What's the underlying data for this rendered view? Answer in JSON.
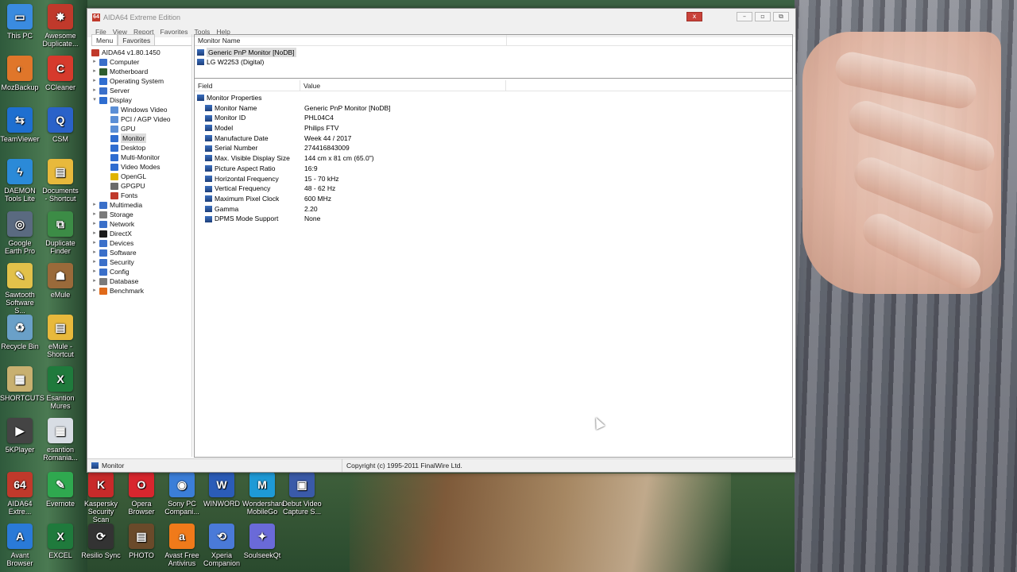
{
  "window": {
    "title": "AIDA64 Extreme Edition",
    "menu": [
      "File",
      "View",
      "Report",
      "Favorites",
      "Tools",
      "Help"
    ],
    "controls": {
      "close": "x",
      "minimize": "–",
      "maximize": "▫",
      "restore": "⧉"
    }
  },
  "left_pane": {
    "tabs": [
      "Menu",
      "Favorites"
    ],
    "root": "AIDA64 v1.80.1450",
    "tree": [
      {
        "label": "Computer",
        "expander": "▸",
        "icon_color": "#3a6fc9"
      },
      {
        "label": "Motherboard",
        "expander": "▸",
        "icon_color": "#2e5d2e"
      },
      {
        "label": "Operating System",
        "expander": "▸",
        "icon_color": "#2f6dd0"
      },
      {
        "label": "Server",
        "expander": "▸",
        "icon_color": "#3a6fc9"
      },
      {
        "label": "Display",
        "expander": "▾",
        "icon_color": "#2f6dd0"
      },
      {
        "label": "Windows Video",
        "child": true,
        "icon_color": "#5b8fd6"
      },
      {
        "label": "PCI / AGP Video",
        "child": true,
        "icon_color": "#5b8fd6"
      },
      {
        "label": "GPU",
        "child": true,
        "icon_color": "#5b8fd6"
      },
      {
        "label": "Monitor",
        "child": true,
        "selected": true,
        "icon_color": "#2f6dd0"
      },
      {
        "label": "Desktop",
        "child": true,
        "icon_color": "#2f6dd0"
      },
      {
        "label": "Multi-Monitor",
        "child": true,
        "icon_color": "#2f6dd0"
      },
      {
        "label": "Video Modes",
        "child": true,
        "icon_color": "#2f6dd0"
      },
      {
        "label": "OpenGL",
        "child": true,
        "icon_color": "#e0b400"
      },
      {
        "label": "GPGPU",
        "child": true,
        "icon_color": "#6a6a6a"
      },
      {
        "label": "Fonts",
        "child": true,
        "icon_color": "#c0392b"
      },
      {
        "label": "Multimedia",
        "expander": "▸",
        "icon_color": "#3a6fc9"
      },
      {
        "label": "Storage",
        "expander": "▸",
        "icon_color": "#7a7a7a"
      },
      {
        "label": "Network",
        "expander": "▸",
        "icon_color": "#3a6fc9"
      },
      {
        "label": "DirectX",
        "expander": "▸",
        "icon_color": "#1a1a1a"
      },
      {
        "label": "Devices",
        "expander": "▸",
        "icon_color": "#3a6fc9"
      },
      {
        "label": "Software",
        "expander": "▸",
        "icon_color": "#3a6fc9"
      },
      {
        "label": "Security",
        "expander": "▸",
        "icon_color": "#3a6fc9"
      },
      {
        "label": "Config",
        "expander": "▸",
        "icon_color": "#3a6fc9"
      },
      {
        "label": "Database",
        "expander": "▸",
        "icon_color": "#7a7a7a"
      },
      {
        "label": "Benchmark",
        "expander": "▸",
        "icon_color": "#e06a1a"
      }
    ]
  },
  "devices": {
    "header": "Monitor Name",
    "items": [
      {
        "label": "Generic PnP Monitor [NoDB]",
        "selected": true
      },
      {
        "label": "LG W2253 (Digital)",
        "selected": false
      }
    ]
  },
  "grid": {
    "headers": [
      "Field",
      "Value"
    ],
    "section": "Monitor Properties",
    "rows": [
      {
        "field": "Monitor Name",
        "value": "Generic PnP Monitor [NoDB]"
      },
      {
        "field": "Monitor ID",
        "value": "PHL04C4"
      },
      {
        "field": "Model",
        "value": "Philips FTV"
      },
      {
        "field": "Manufacture Date",
        "value": "Week 44 / 2017"
      },
      {
        "field": "Serial Number",
        "value": "274416843009"
      },
      {
        "field": "Max. Visible Display Size",
        "value": "144 cm x 81 cm (65.0\")"
      },
      {
        "field": "Picture Aspect Ratio",
        "value": "16:9"
      },
      {
        "field": "Horizontal Frequency",
        "value": "15 - 70 kHz"
      },
      {
        "field": "Vertical Frequency",
        "value": "48 - 62 Hz"
      },
      {
        "field": "Maximum Pixel Clock",
        "value": "600 MHz"
      },
      {
        "field": "Gamma",
        "value": "2.20"
      },
      {
        "field": "DPMS Mode Support",
        "value": "None"
      }
    ]
  },
  "statusbar": {
    "left": "Monitor",
    "right": "Copyright (c) 1995-2011 FinalWire Ltd."
  },
  "desktop_icons": [
    {
      "label": "This PC",
      "icon": "pc-icon",
      "color": "#3a8be0",
      "glyph": "▭"
    },
    {
      "label": "Awesome Duplicate...",
      "icon": "awesome-duplicate-icon",
      "color": "#c0392b",
      "glyph": "✸"
    },
    {
      "label": "MozBackup",
      "icon": "mozbackup-icon",
      "color": "#e0762a",
      "glyph": "◐"
    },
    {
      "label": "CCleaner",
      "icon": "ccleaner-icon",
      "color": "#d63a2c",
      "glyph": "C"
    },
    {
      "label": "TeamViewer",
      "icon": "teamviewer-icon",
      "color": "#1e6fd0",
      "glyph": "⇆"
    },
    {
      "label": "CSM",
      "icon": "csm-icon",
      "color": "#2a62c9",
      "glyph": "Q"
    },
    {
      "label": "DAEMON Tools Lite",
      "icon": "daemon-tools-icon",
      "color": "#2b8ad8",
      "glyph": "ϟ"
    },
    {
      "label": "Documents - Shortcut",
      "icon": "folder-icon",
      "color": "#e8b93c",
      "glyph": "▤"
    },
    {
      "label": "Google Earth Pro",
      "icon": "google-earth-icon",
      "color": "#5a6a80",
      "glyph": "◎"
    },
    {
      "label": "Duplicate Finder",
      "icon": "duplicate-finder-icon",
      "color": "#3c8c46",
      "glyph": "⧉"
    },
    {
      "label": "Sawtooth Software S...",
      "icon": "sawtooth-icon",
      "color": "#e2c14a",
      "glyph": "✎"
    },
    {
      "label": "eMule",
      "icon": "emule-icon",
      "color": "#9a6a3a",
      "glyph": "☗"
    },
    {
      "label": "Recycle Bin",
      "icon": "recycle-bin-icon",
      "color": "#6aa0c8",
      "glyph": "♻"
    },
    {
      "label": "eMule - Shortcut",
      "icon": "folder-icon",
      "color": "#e8b93c",
      "glyph": "▤"
    },
    {
      "label": "SHORTCUTS",
      "icon": "shortcuts-icon",
      "color": "#c8b070",
      "glyph": "▦"
    },
    {
      "label": "Esantion Mures",
      "icon": "excel-icon",
      "color": "#1f7a3c",
      "glyph": "X"
    },
    {
      "label": "5KPlayer",
      "icon": "5kplayer-icon",
      "color": "#444",
      "glyph": "▶"
    },
    {
      "label": "esantion Romania...",
      "icon": "spreadsheet-icon",
      "color": "#d8dde4",
      "glyph": "▦"
    },
    {
      "label": "AIDA64 Extre...",
      "icon": "aida64-icon",
      "color": "#c0392b",
      "glyph": "64"
    },
    {
      "label": "Evernote",
      "icon": "evernote-icon",
      "color": "#2fa84f",
      "glyph": "✎"
    },
    {
      "label": "Kaspersky Security Scan",
      "icon": "kaspersky-icon",
      "color": "#c82a2a",
      "glyph": "K"
    },
    {
      "label": "Opera Browser",
      "icon": "opera-icon",
      "color": "#d8262e",
      "glyph": "O"
    },
    {
      "label": "Sony PC Compani...",
      "icon": "sony-pc-companion-icon",
      "color": "#3b7ed8",
      "glyph": "◉"
    },
    {
      "label": "WINWORD",
      "icon": "word-icon",
      "color": "#2b5cb8",
      "glyph": "W"
    },
    {
      "label": "Wondershare MobileGo",
      "icon": "mobilego-icon",
      "color": "#1e9ad6",
      "glyph": "M"
    },
    {
      "label": "Debut Video Capture S...",
      "icon": "debut-video-icon",
      "color": "#3a5aa8",
      "glyph": "▣"
    },
    {
      "label": "Avant Browser",
      "icon": "avant-browser-icon",
      "color": "#2a7ad8",
      "glyph": "A"
    },
    {
      "label": "EXCEL",
      "icon": "excel-icon",
      "color": "#1f7a3c",
      "glyph": "X"
    },
    {
      "label": "Resilio Sync",
      "icon": "resilio-sync-icon",
      "color": "#333",
      "glyph": "⟳"
    },
    {
      "label": "PHOTO",
      "icon": "photo-folder-icon",
      "color": "#6a4a2a",
      "glyph": "▤"
    },
    {
      "label": "Avast Free Antivirus",
      "icon": "avast-icon",
      "color": "#f07a1a",
      "glyph": "a"
    },
    {
      "label": "Xperia Companion",
      "icon": "xperia-icon",
      "color": "#4a7ad8",
      "glyph": "⟲"
    },
    {
      "label": "SoulseekQt",
      "icon": "soulseek-icon",
      "color": "#6a6ad8",
      "glyph": "✦"
    }
  ]
}
